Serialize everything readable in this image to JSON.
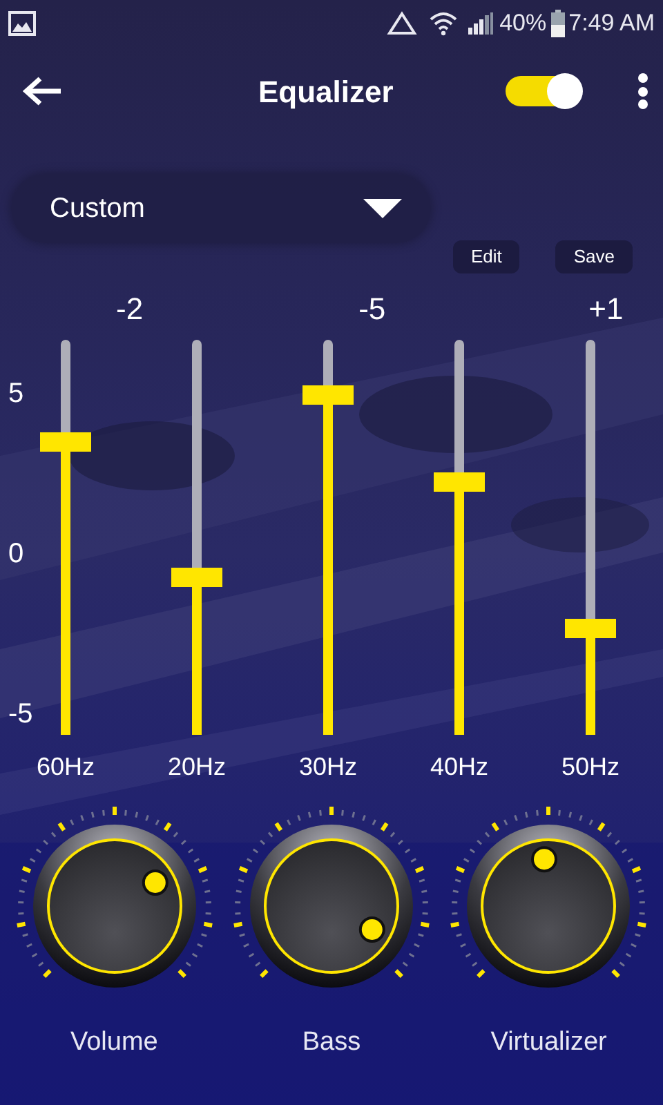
{
  "status_bar": {
    "battery": "40%",
    "time": "7:49 AM"
  },
  "app_bar": {
    "title": "Equalizer",
    "enabled": true
  },
  "preset": {
    "value": "Custom"
  },
  "buttons": [
    "Edit",
    "Save"
  ],
  "readings": [
    "-2",
    "-5",
    "+1"
  ],
  "scale": [
    "5",
    "0",
    "-5"
  ],
  "bands": [
    {
      "label": "60Hz",
      "level": 0.74
    },
    {
      "label": "20Hz",
      "level": 0.4
    },
    {
      "label": "30Hz",
      "level": 0.86
    },
    {
      "label": "40Hz",
      "level": 0.64
    },
    {
      "label": "50Hz",
      "level": 0.27
    }
  ],
  "knobs": [
    {
      "label": "Volume"
    },
    {
      "label": "Bass"
    },
    {
      "label": "Virtualizer"
    }
  ]
}
